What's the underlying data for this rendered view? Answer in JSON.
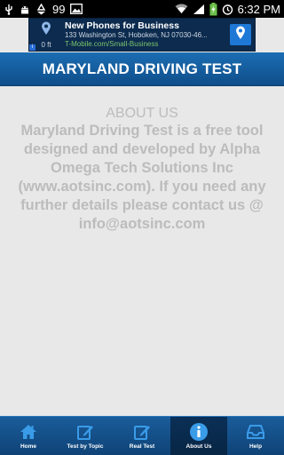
{
  "status_bar": {
    "notification_count": "99",
    "time": "6:32 PM",
    "icons": [
      "usb-icon",
      "android-debug-icon",
      "recycle-icon",
      "image-icon",
      "wifi-icon",
      "signal-icon",
      "battery-charging-icon",
      "alarm-icon"
    ]
  },
  "ad": {
    "title": "New Phones for Business",
    "address": "133 Washington St, Hoboken, NJ 07030-46...",
    "url": "T-Mobile.com/Small-Business",
    "distance": "0 ft",
    "badge": "i",
    "icons": [
      "map-pin-icon",
      "navigation-pin-icon"
    ]
  },
  "header": {
    "title": "MARYLAND DRIVING TEST"
  },
  "about": {
    "heading": "ABOUT US",
    "body": "Maryland Driving Test is a free tool designed and developed by Alpha Omega Tech Solutions Inc (www.aotsinc.com). If you need any further details please contact us @ info@aotsinc.com"
  },
  "nav": {
    "items": [
      {
        "label": "Home",
        "icon": "home-icon"
      },
      {
        "label": "Test by Topic",
        "icon": "edit-icon"
      },
      {
        "label": "Real Test",
        "icon": "edit-icon"
      },
      {
        "label": "About Us",
        "icon": "info-icon"
      },
      {
        "label": "Help",
        "icon": "inbox-icon"
      }
    ],
    "active": "About Us"
  },
  "colors": {
    "accent": "#145a9a",
    "nav_active": "#0a2f56",
    "text_muted": "#bcbcbc"
  }
}
